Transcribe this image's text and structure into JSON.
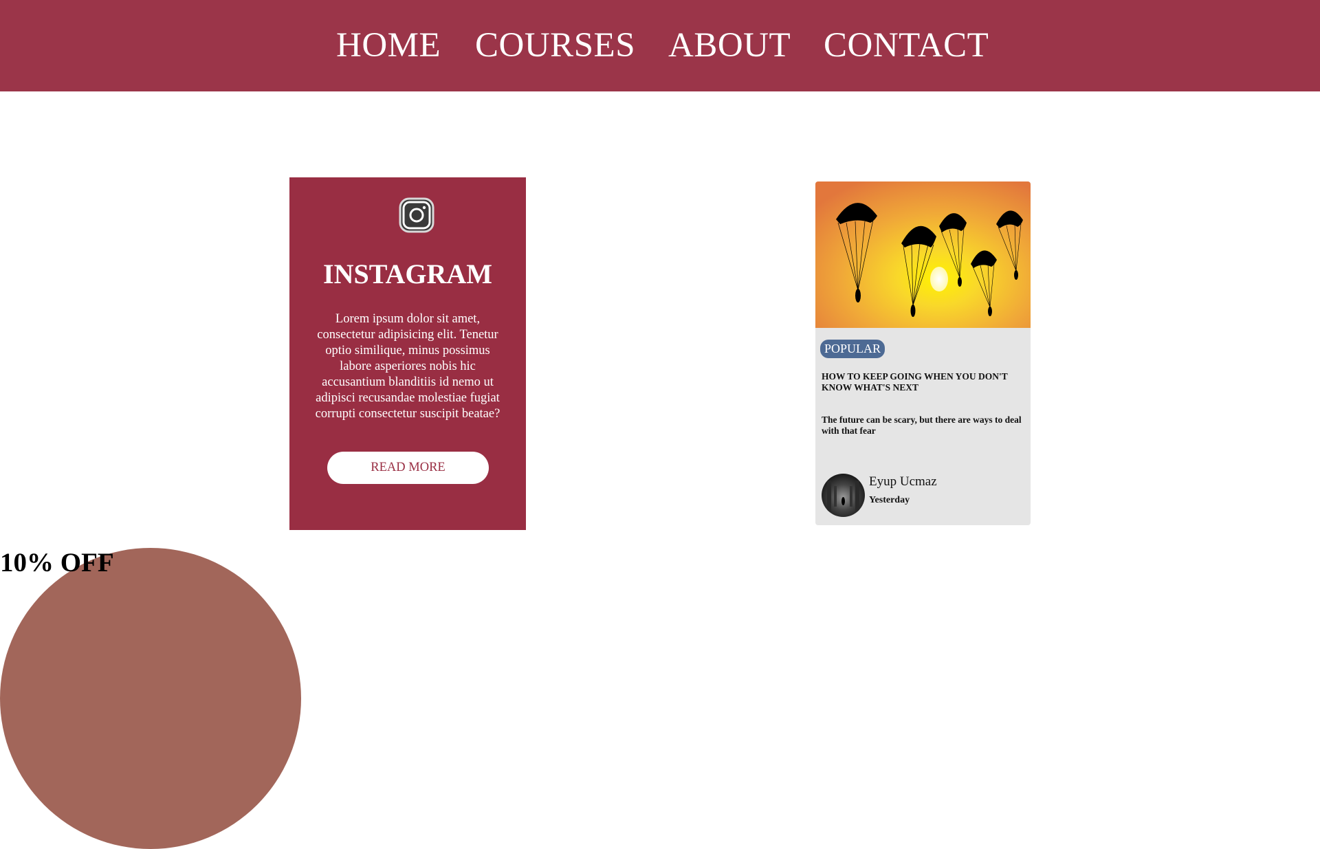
{
  "nav": {
    "items": [
      "HOME",
      "COURSES",
      "ABOUT",
      "CONTACT"
    ],
    "background": "#9b3549"
  },
  "instagram_card": {
    "icon": "instagram-icon",
    "title": "INSTAGRAM",
    "text": "Lorem ipsum dolor sit amet, consectetur adipisicing elit. Tenetur optio similique, minus possimus labore asperiores nobis hic accusantium blanditiis id nemo ut adipisci recusandae molestiae fugiat corrupti consectetur suscipit beatae?",
    "button_label": "READ MORE",
    "background": "#992e43"
  },
  "blog_card": {
    "image": "parachutes-image",
    "badge": "POPULAR",
    "title": "HOW TO KEEP GOING WHEN YOU DON'T KNOW WHAT'S NEXT",
    "subtitle": "The future can be scary, but there are ways to deal with that fear",
    "author": "Eyup Ucmaz",
    "date": "Yesterday",
    "badge_color": "#4d6a94"
  },
  "discount": {
    "label": "10% OFF",
    "circle_color": "#a2665a"
  }
}
